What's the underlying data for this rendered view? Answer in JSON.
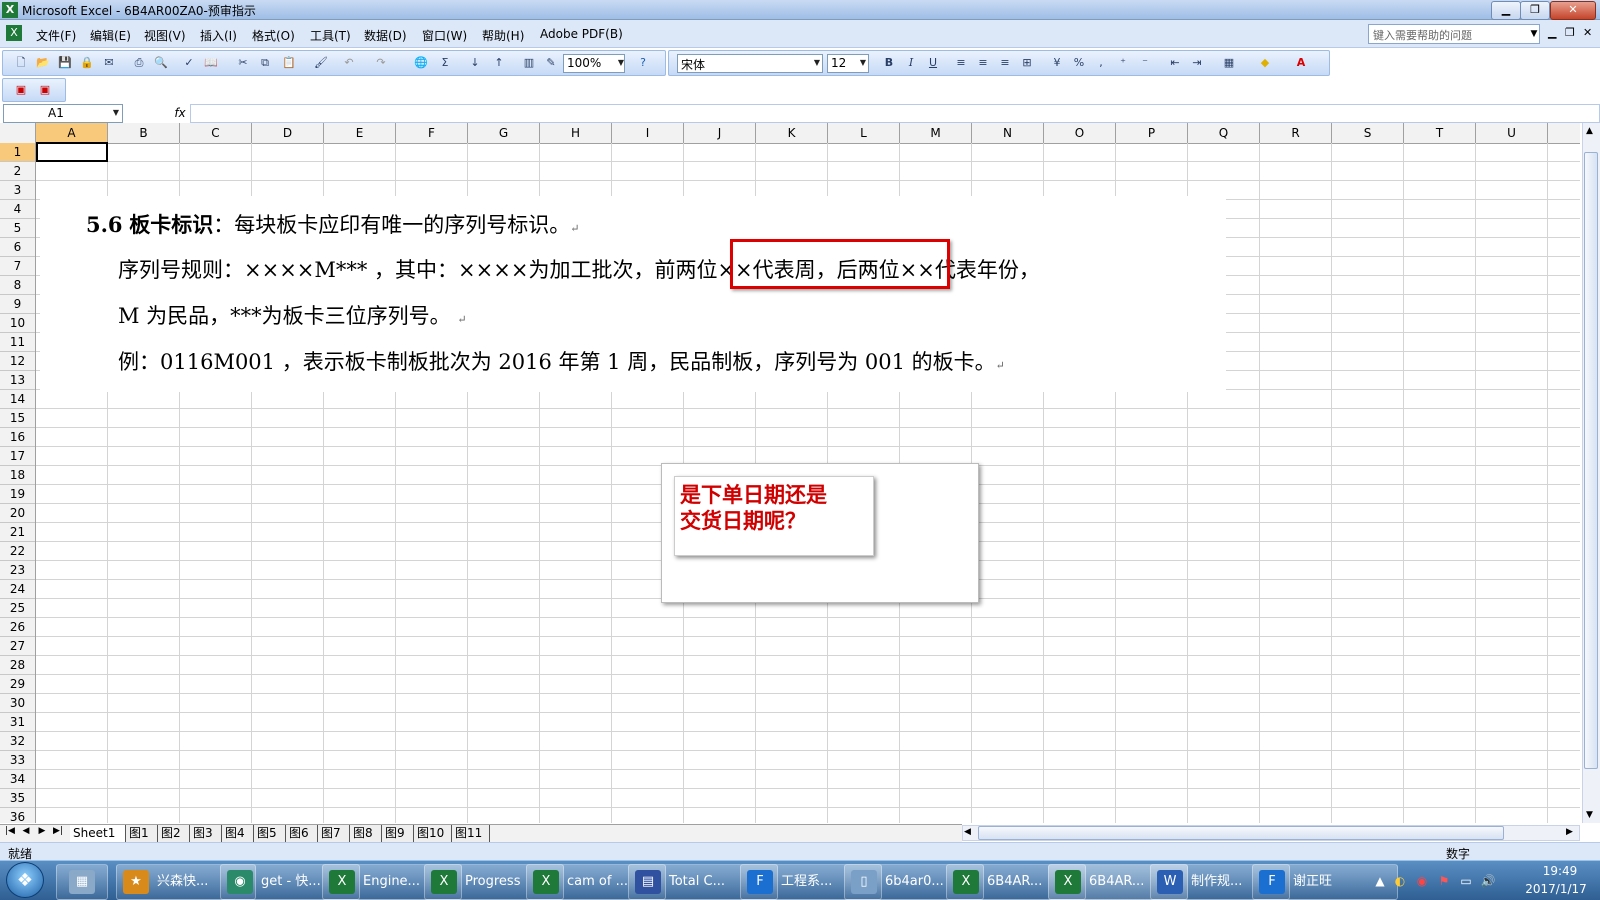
{
  "window": {
    "title": "Microsoft Excel - 6B4AR00ZA0-预审指示",
    "app_icon": "X"
  },
  "menu": {
    "items": [
      "文件(F)",
      "编辑(E)",
      "视图(V)",
      "插入(I)",
      "格式(O)",
      "工具(T)",
      "数据(D)",
      "窗口(W)",
      "帮助(H)",
      "Adobe PDF(B)"
    ],
    "help_placeholder": "键入需要帮助的问题"
  },
  "toolbar": {
    "zoom": "100%",
    "font_name": "宋体",
    "font_size": "12",
    "bold": "B",
    "italic": "I",
    "underline": "U",
    "percent": "%",
    "comma": ","
  },
  "formula_bar": {
    "cell_ref": "A1",
    "fx": "fx",
    "content": ""
  },
  "grid": {
    "columns": [
      "A",
      "B",
      "C",
      "D",
      "E",
      "F",
      "G",
      "H",
      "I",
      "J",
      "K",
      "L",
      "M",
      "N",
      "O",
      "P",
      "Q",
      "R",
      "S",
      "T",
      "U"
    ],
    "rows": [
      "1",
      "2",
      "3",
      "4",
      "5",
      "6",
      "7",
      "8",
      "9",
      "10",
      "11",
      "12",
      "13",
      "14",
      "15",
      "16",
      "17",
      "18",
      "19",
      "20",
      "21",
      "22",
      "23",
      "24",
      "25",
      "26",
      "27",
      "28",
      "29",
      "30",
      "31",
      "32",
      "33",
      "34",
      "35",
      "36"
    ],
    "active_cell": "A1"
  },
  "document": {
    "heading_num": "5.6",
    "heading_bold": "板卡标识",
    "heading_rest": "：每块板卡应印有唯一的序列号标识。",
    "line2_a": "序列号规则：××××M*** ，其中：××××为加工批次，",
    "line2_b": "前两位××代表周，",
    "line2_c": "后两位××代表年份，",
    "line3": "M 为民品，***为板卡三位序列号。",
    "line4": "例：0116M001 ，表示板卡制板批次为 2016 年第 1 周，民品制板，序列号为 001 的板卡。",
    "return_mark": "↵"
  },
  "comment": {
    "line1": "是下单日期还是",
    "line2": "交货日期呢？"
  },
  "sheet_tabs": [
    "Sheet1",
    "图1",
    "图2",
    "图3",
    "图4",
    "图5",
    "图6",
    "图7",
    "图8",
    "图9",
    "图10",
    "图11"
  ],
  "status": {
    "left": "就绪",
    "right": "数字"
  },
  "taskbar": {
    "tasks": [
      {
        "label": "兴森快...",
        "icon": "star-app-icon"
      },
      {
        "label": "get - 快...",
        "icon": "eye-app-icon"
      },
      {
        "label": "Engine...",
        "icon": "excel-icon"
      },
      {
        "label": "Progress",
        "icon": "excel-icon"
      },
      {
        "label": "cam of ...",
        "icon": "excel-icon"
      },
      {
        "label": "Total C...",
        "icon": "floppy-icon"
      },
      {
        "label": "工程系...",
        "icon": "f-app-icon"
      },
      {
        "label": "6b4ar0...",
        "icon": "document-icon"
      },
      {
        "label": "6B4AR...",
        "icon": "excel-icon"
      },
      {
        "label": "6B4AR...",
        "icon": "excel-icon"
      },
      {
        "label": "制作规...",
        "icon": "word-icon"
      },
      {
        "label": "谢正旺",
        "icon": "f-app-icon"
      }
    ],
    "time": "19:49",
    "date": "2017/1/17"
  },
  "colors": {
    "accent_red": "#d00000",
    "selection_header": "#f8c97a",
    "taskbar": "#2f5f93"
  }
}
